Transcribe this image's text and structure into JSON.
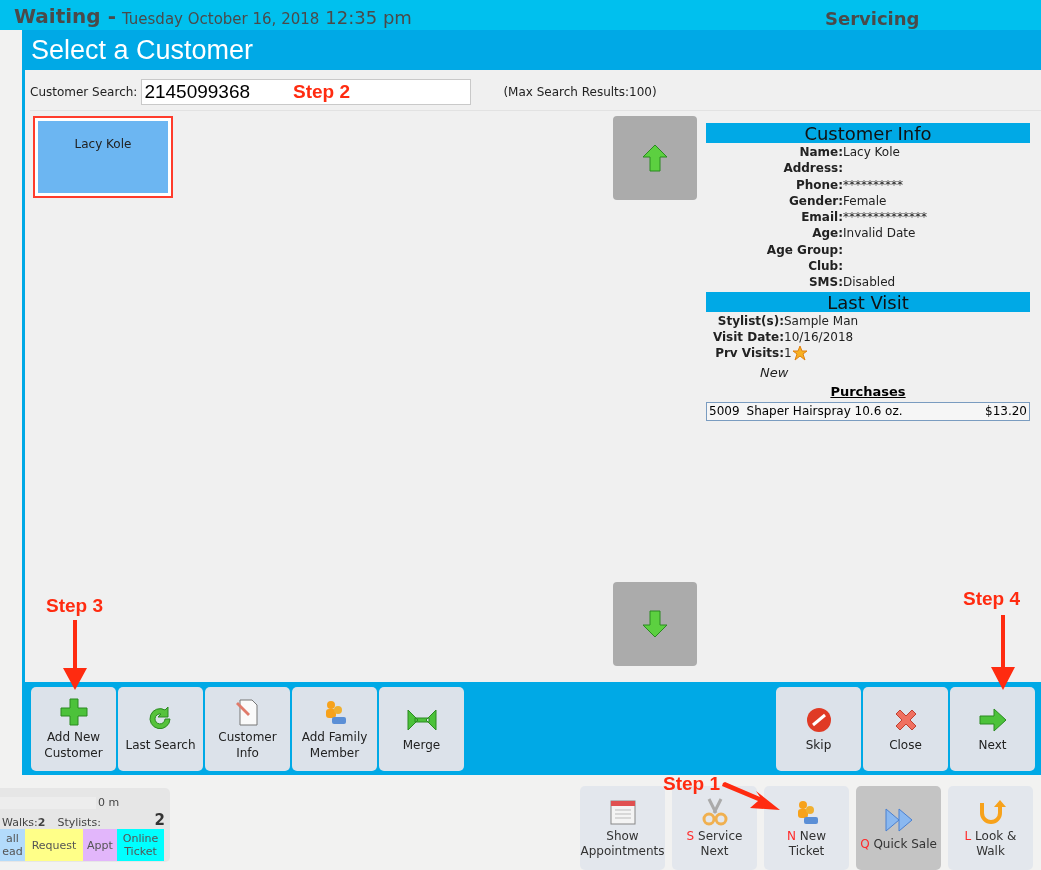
{
  "header": {
    "status": "Waiting -",
    "date": "Tuesday October 16, 2018",
    "time": "12:35 pm",
    "section": "Servicing"
  },
  "dialog": {
    "title": "Select a Customer",
    "search": {
      "label": "Customer Search:",
      "value": "2145099368",
      "note": "(Max Search Results:100)"
    },
    "customers": [
      {
        "name": "Lacy Kole",
        "selected": true
      }
    ],
    "customer_info": {
      "title": "Customer Info",
      "fields": [
        {
          "label": "Name:",
          "value": "Lacy Kole"
        },
        {
          "label": "Address:"
        },
        {
          "label": "Phone:",
          "value": "**********"
        },
        {
          "label": "Gender:",
          "value": "Female"
        },
        {
          "label": "Email:",
          "value": "**************"
        },
        {
          "label": "Age:",
          "value": "Invalid Date"
        },
        {
          "label": "Age Group:"
        },
        {
          "label": "Club:"
        },
        {
          "label": "SMS:",
          "value": "Disabled"
        }
      ]
    },
    "last_visit": {
      "title": "Last Visit",
      "fields": [
        {
          "label": "Stylist(s):",
          "value": "Sample Man",
          "kind": "text"
        },
        {
          "label": "Visit Date:",
          "value": "10/16/2018",
          "kind": "text"
        },
        {
          "label": "Prv Visits:",
          "value": "1",
          "kind": "star"
        }
      ],
      "status": "New",
      "purchases_title": "Purchases",
      "purchases": [
        {
          "code": "5009",
          "name": "Shaper Hairspray 10.6 oz.",
          "price": "$13.20"
        }
      ]
    },
    "toolbar_left": [
      {
        "label": "Add New\nCustomer",
        "kind": "plus"
      },
      {
        "label": "Last Search",
        "kind": "redo"
      },
      {
        "label": "Customer\nInfo",
        "kind": "document"
      },
      {
        "label": "Add Family\nMember",
        "kind": "people"
      },
      {
        "label": "Merge",
        "kind": "merge"
      }
    ],
    "toolbar_right": [
      {
        "label": "Skip",
        "kind": "skip"
      },
      {
        "label": "Close",
        "kind": "close"
      },
      {
        "label": "Next",
        "kind": "next"
      }
    ]
  },
  "queue": {
    "wait": "0 m",
    "walks_label": "Walks:",
    "walks": "2",
    "stylists_label": "Stylists:",
    "stylists": "2",
    "categories": [
      {
        "label": "all\nead",
        "color": "#b3dbfb"
      },
      {
        "label": "Request",
        "color": "#ffff88"
      },
      {
        "label": "Appt",
        "color": "#e2b6fb"
      },
      {
        "label": "Online\nTicket",
        "color": "#00ffff"
      }
    ]
  },
  "actions": [
    {
      "label": "Show\nAppointments",
      "kind": "calendar",
      "selected": false
    },
    {
      "hotkey": "S",
      "label": "Service\nNext",
      "kind": "scissors",
      "selected": false
    },
    {
      "hotkey": "N",
      "label": "New\nTicket",
      "kind": "people",
      "selected": false
    },
    {
      "hotkey": "Q",
      "label": "Quick Sale",
      "kind": "forward",
      "selected": true
    },
    {
      "hotkey": "L",
      "label": "Look &\nWalk",
      "kind": "uturn",
      "selected": false
    }
  ],
  "annotations": [
    {
      "text": "Step 2"
    },
    {
      "text": "Step 3"
    },
    {
      "text": "Step 4"
    },
    {
      "text": "Step 1"
    }
  ]
}
